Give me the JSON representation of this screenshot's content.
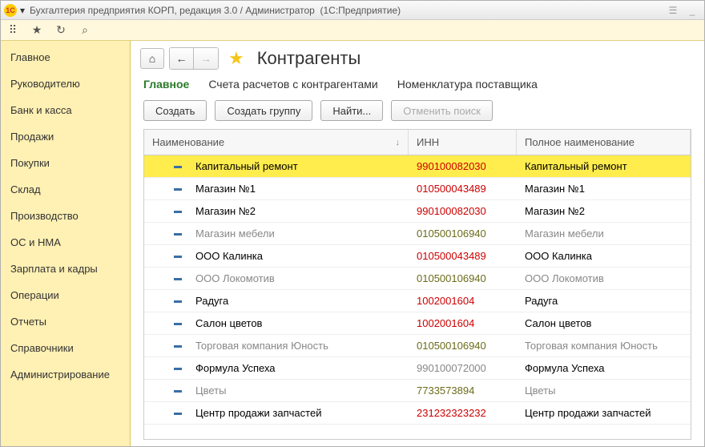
{
  "window": {
    "app_icon_text": "1C",
    "title_part1": "Бухгалтерия предприятия КОРП, редакция 3.0 / Администратор",
    "title_part2": "(1С:Предприятие)"
  },
  "sidebar": {
    "items": [
      {
        "label": "Главное"
      },
      {
        "label": "Руководителю"
      },
      {
        "label": "Банк и касса"
      },
      {
        "label": "Продажи"
      },
      {
        "label": "Покупки"
      },
      {
        "label": "Склад"
      },
      {
        "label": "Производство"
      },
      {
        "label": "ОС и НМА"
      },
      {
        "label": "Зарплата и кадры"
      },
      {
        "label": "Операции"
      },
      {
        "label": "Отчеты"
      },
      {
        "label": "Справочники"
      },
      {
        "label": "Администрирование"
      }
    ]
  },
  "page": {
    "title": "Контрагенты",
    "tabs": [
      {
        "label": "Главное",
        "active": true
      },
      {
        "label": "Счета расчетов с контрагентами",
        "active": false
      },
      {
        "label": "Номенклатура поставщика",
        "active": false
      }
    ],
    "buttons": {
      "create": "Создать",
      "create_group": "Создать группу",
      "find": "Найти...",
      "cancel_search": "Отменить поиск"
    }
  },
  "grid": {
    "cols": {
      "name": "Наименование",
      "inn": "ИНН",
      "fullname": "Полное наименование"
    },
    "rows": [
      {
        "name": "Капитальный ремонт",
        "inn": "990100082030",
        "inn_style": "inn-red",
        "full": "Капитальный ремонт",
        "selected": true,
        "inactive": false
      },
      {
        "name": "Магазин №1",
        "inn": "010500043489",
        "inn_style": "inn-red",
        "full": "Магазин №1",
        "selected": false,
        "inactive": false
      },
      {
        "name": "Магазин №2",
        "inn": "990100082030",
        "inn_style": "inn-red",
        "full": "Магазин №2",
        "selected": false,
        "inactive": false
      },
      {
        "name": "Магазин мебели",
        "inn": "010500106940",
        "inn_style": "inn-olive",
        "full": "Магазин мебели",
        "selected": false,
        "inactive": true
      },
      {
        "name": "ООО Калинка",
        "inn": "010500043489",
        "inn_style": "inn-red",
        "full": "ООО Калинка",
        "selected": false,
        "inactive": false
      },
      {
        "name": "ООО Локомотив",
        "inn": "010500106940",
        "inn_style": "inn-olive",
        "full": "ООО Локомотив",
        "selected": false,
        "inactive": true
      },
      {
        "name": "Радуга",
        "inn": "1002001604",
        "inn_style": "inn-red",
        "full": "Радуга",
        "selected": false,
        "inactive": false
      },
      {
        "name": "Салон цветов",
        "inn": "1002001604",
        "inn_style": "inn-red",
        "full": "Салон цветов",
        "selected": false,
        "inactive": false
      },
      {
        "name": "Торговая компания Юность",
        "inn": "010500106940",
        "inn_style": "inn-olive",
        "full": "Торговая компания Юность",
        "selected": false,
        "inactive": true
      },
      {
        "name": "Формула Успеха",
        "inn": "990100072000",
        "inn_style": "inn-gray",
        "full": "Формула Успеха",
        "selected": false,
        "inactive": false
      },
      {
        "name": "Цветы",
        "inn": "7733573894",
        "inn_style": "inn-olive",
        "full": "Цветы",
        "selected": false,
        "inactive": true
      },
      {
        "name": "Центр продажи запчастей",
        "inn": "231232323232",
        "inn_style": "inn-red",
        "full": "Центр продажи запчастей",
        "selected": false,
        "inactive": false
      }
    ]
  }
}
